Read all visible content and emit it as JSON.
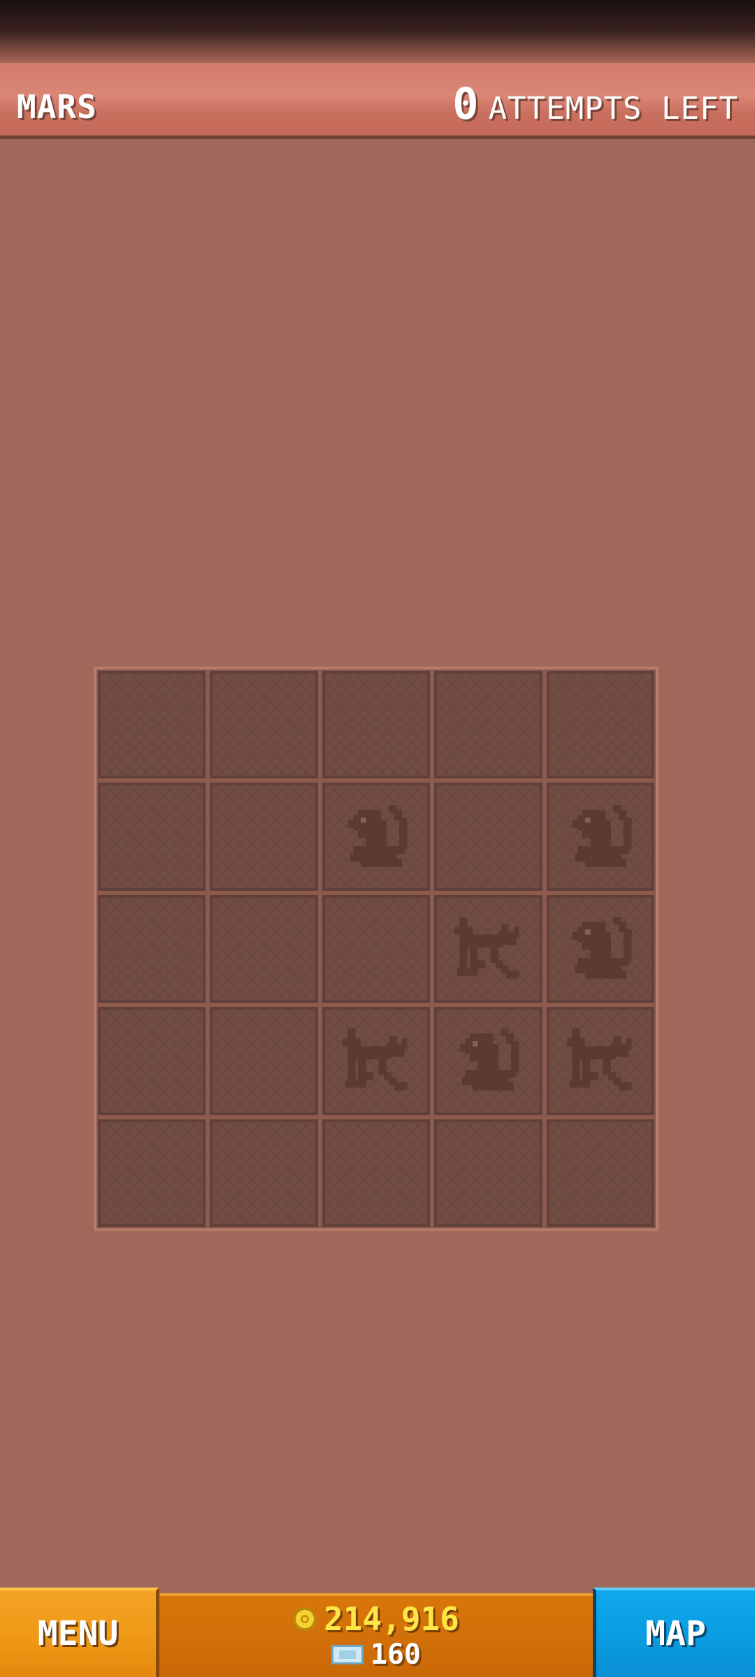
{
  "header": {
    "location": "MARS",
    "attempts_count": "0",
    "attempts_label": "ATTEMPTS LEFT"
  },
  "board": {
    "rows": 5,
    "cols": 5,
    "cells": [
      [
        "empty",
        "empty",
        "empty",
        "empty",
        "empty"
      ],
      [
        "empty",
        "empty",
        "monkey-icon",
        "empty",
        "monkey-icon"
      ],
      [
        "empty",
        "empty",
        "empty",
        "dog-icon",
        "monkey-icon"
      ],
      [
        "empty",
        "empty",
        "dog-icon",
        "monkey-icon",
        "dog-icon"
      ],
      [
        "empty",
        "empty",
        "empty",
        "empty",
        "empty"
      ]
    ]
  },
  "footer": {
    "menu_label": "MENU",
    "coins": "214,916",
    "gems": "160",
    "map_label": "MAP"
  },
  "colors": {
    "background": "#9f685b",
    "header": "#d27c6c",
    "cell": "#714c42",
    "icon": "#5a3a31",
    "menu_button": "#f09a17",
    "currency_panel": "#d06f09",
    "map_button": "#0a9de2",
    "coin_text": "#ffe646"
  }
}
